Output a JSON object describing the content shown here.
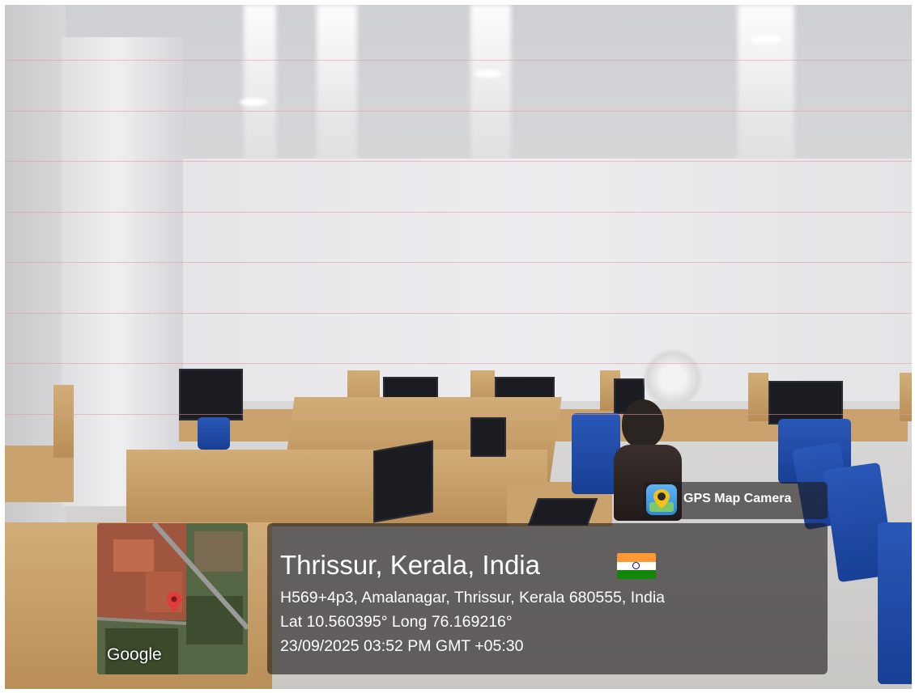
{
  "watermark": {
    "app_name": "GPS Map Camera",
    "location_title": "Thrissur, Kerala, India",
    "address": "H569+4p3, Amalanagar, Thrissur, Kerala 680555, India",
    "coordinates": "Lat 10.560395° Long 76.169216°",
    "datetime": "23/09/2025 03:52 PM GMT +05:30",
    "map_brand": "Google",
    "country_flag": "india-flag",
    "flag_colors": [
      "#FF9933",
      "#FFFFFF",
      "#138808"
    ],
    "chakra_color": "#000080"
  },
  "scene": {
    "accent_chair_color": "#2450a8",
    "desk_color": "#c9a26d"
  }
}
